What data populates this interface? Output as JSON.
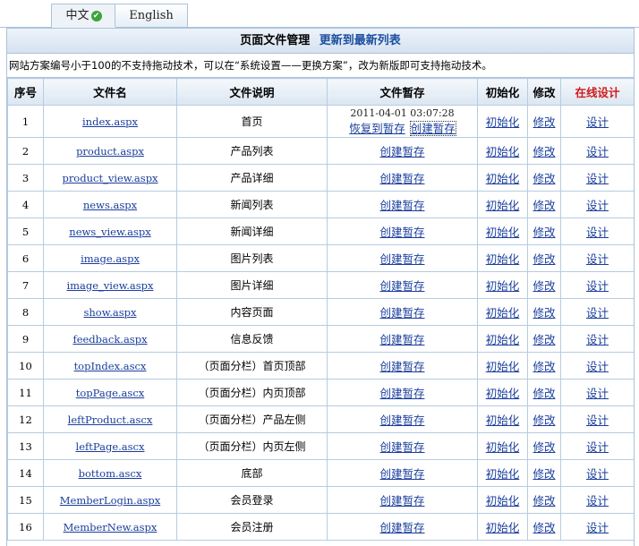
{
  "tabs": [
    {
      "label": "中文",
      "active": true
    },
    {
      "label": "English",
      "active": false
    }
  ],
  "header": {
    "title": "页面文件管理",
    "update_link": "更新到最新列表"
  },
  "notice": "网站方案编号小于100的不支持拖动技术，可以在“系统设置——更换方案”，改为新版即可支持拖动技术。",
  "columns": [
    "序号",
    "文件名",
    "文件说明",
    "文件暂存",
    "初始化",
    "修改",
    "在线设计"
  ],
  "accent_color": "#d11a1a",
  "link_color": "#1a3e9c",
  "actions": {
    "create_draft": "创建暂存",
    "restore_draft": "恢复到暂存",
    "init": "初始化",
    "edit": "修改",
    "design": "设计"
  },
  "rows": [
    {
      "no": "1",
      "file": "index.aspx",
      "desc": "首页",
      "draft_time": "2011-04-01 03:07:28",
      "has_draft": true
    },
    {
      "no": "2",
      "file": "product.aspx",
      "desc": "产品列表"
    },
    {
      "no": "3",
      "file": "product_view.aspx",
      "desc": "产品详细"
    },
    {
      "no": "4",
      "file": "news.aspx",
      "desc": "新闻列表"
    },
    {
      "no": "5",
      "file": "news_view.aspx",
      "desc": "新闻详细"
    },
    {
      "no": "6",
      "file": "image.aspx",
      "desc": "图片列表"
    },
    {
      "no": "7",
      "file": "image_view.aspx",
      "desc": "图片详细"
    },
    {
      "no": "8",
      "file": "show.aspx",
      "desc": "内容页面"
    },
    {
      "no": "9",
      "file": "feedback.aspx",
      "desc": "信息反馈"
    },
    {
      "no": "10",
      "file": "topIndex.ascx",
      "desc": "（页面分栏）首页顶部"
    },
    {
      "no": "11",
      "file": "topPage.ascx",
      "desc": "（页面分栏）内页顶部"
    },
    {
      "no": "12",
      "file": "leftProduct.ascx",
      "desc": "（页面分栏）产品左侧"
    },
    {
      "no": "13",
      "file": "leftPage.ascx",
      "desc": "（页面分栏）内页左侧"
    },
    {
      "no": "14",
      "file": "bottom.ascx",
      "desc": "底部"
    },
    {
      "no": "15",
      "file": "MemberLogin.aspx",
      "desc": "会员登录"
    },
    {
      "no": "16",
      "file": "MemberNew.aspx",
      "desc": "会员注册"
    }
  ]
}
